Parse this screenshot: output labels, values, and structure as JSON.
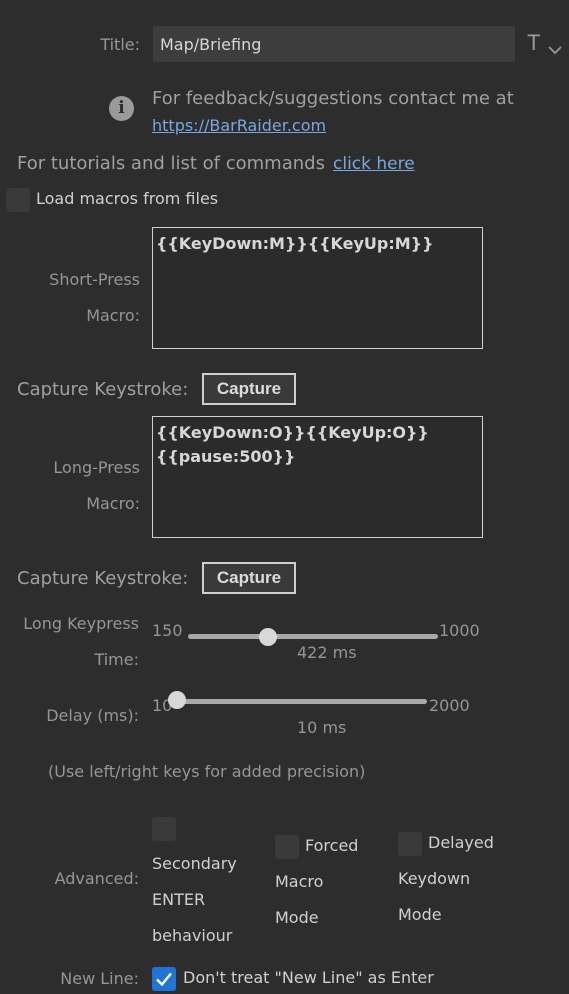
{
  "title_field": {
    "label": "Title:",
    "value": "Map/Briefing",
    "format_icon": "T",
    "chevron": "chevron-down-icon"
  },
  "info": {
    "icon": "info-icon",
    "line1": "For feedback/suggestions contact me at",
    "link": "https://BarRaider.com"
  },
  "tutorials": {
    "text": "For tutorials and list of commands",
    "link": "click here"
  },
  "load_macros": {
    "label": "Load macros from files",
    "checked": false
  },
  "short_press": {
    "label_line1": "Short-Press",
    "label_line2": "Macro:",
    "value": "{{KeyDown:M}}{{KeyUp:M}}"
  },
  "capture1": {
    "label": "Capture Keystroke:",
    "button": "Capture"
  },
  "long_press": {
    "label_line1": "Long-Press",
    "label_line2": "Macro:",
    "value": "{{KeyDown:O}}{{KeyUp:O}}\n{{pause:500}}"
  },
  "capture2": {
    "label": "Capture Keystroke:",
    "button": "Capture"
  },
  "long_keypress": {
    "label_line1": "Long Keypress",
    "label_line2": "Time:",
    "min": "150",
    "max": "1000",
    "value": 422,
    "value_text": "422 ms"
  },
  "delay": {
    "label": "Delay (ms):",
    "min": "10",
    "max": "2000",
    "value": 10,
    "value_text": "10 ms"
  },
  "precision_hint": "(Use left/right keys for added precision)",
  "advanced": {
    "label": "Advanced:",
    "secondary": {
      "lines": [
        "Secondary",
        "ENTER",
        "behaviour"
      ],
      "checked": false
    },
    "forced": {
      "lines": [
        "Forced",
        "Macro",
        "Mode"
      ],
      "checked": false
    },
    "delayed": {
      "lines": [
        "Delayed",
        "Keydown",
        "Mode"
      ],
      "checked": false
    }
  },
  "new_line": {
    "label": "New Line:",
    "text": "Don't treat \"New Line\" as Enter",
    "checked": true
  },
  "colors": {
    "background": "#2d2d2d",
    "accent": "#1f74d6",
    "link": "#7aa7e0"
  }
}
